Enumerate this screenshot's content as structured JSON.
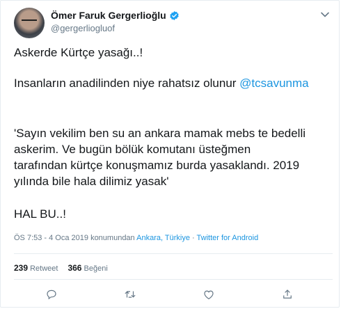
{
  "author": {
    "name": "Ömer Faruk Gergerlioğlu",
    "handle": "@gergerliogluof"
  },
  "tweet": {
    "line1": "Askerde Kürtçe yasağı..!",
    "line2_text": "Insanların anadilinden niye rahatsız olunur",
    "line2_mention": "@tcsavunma",
    "quote_line1": "'Sayın vekilim ben su an ankara mamak mebs te bedelli",
    "quote_line2": "askerim. Ve bugün bölük komutanı üsteğmen",
    "quote_line3": "tarafından kürtçe konuşmamız burda yasaklandı. 2019",
    "quote_line4": "yılında bile hala dilimiz yasak'",
    "closing": "HAL BU..!"
  },
  "meta": {
    "time": "ÖS 7:53 - 4 Oca 2019 konumundan",
    "location": "Ankara, Türkiye",
    "separator": " · ",
    "source": "Twitter for Android"
  },
  "stats": {
    "retweet_count": "239",
    "retweet_label": "Retweet",
    "like_count": "366",
    "like_label": "Beğeni"
  },
  "colors": {
    "link": "#1b95e0",
    "verified": "#1da1f2",
    "muted": "#657786"
  },
  "icons": [
    "verified-icon",
    "chevron-down-icon",
    "reply-icon",
    "retweet-icon",
    "like-icon",
    "share-icon"
  ]
}
